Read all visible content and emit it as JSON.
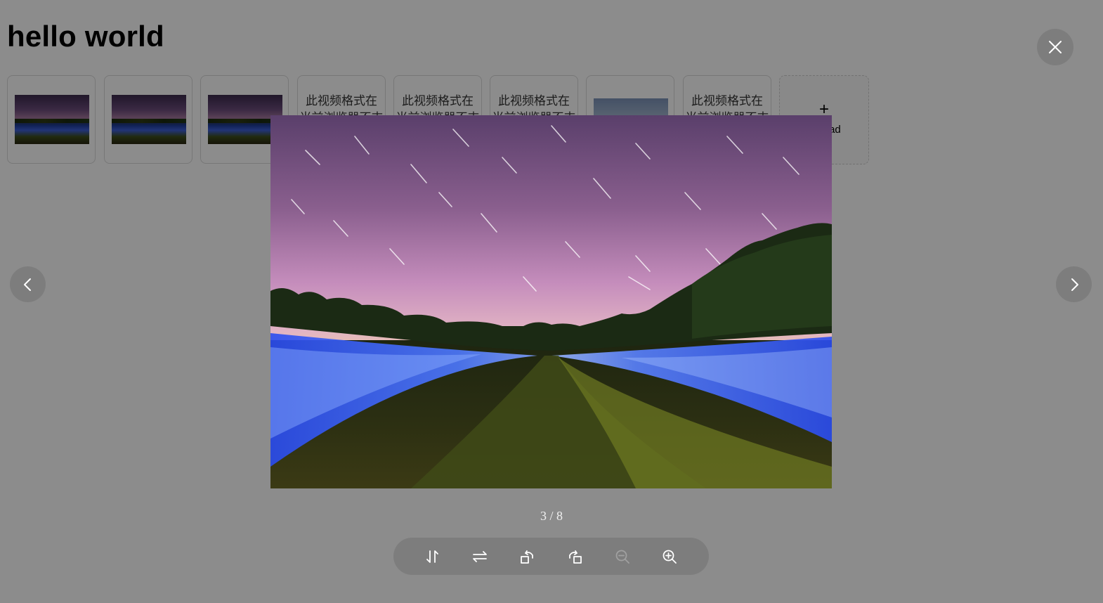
{
  "page": {
    "title": "hello world"
  },
  "upload_list": {
    "items": [
      {
        "type": "image"
      },
      {
        "type": "image"
      },
      {
        "type": "image"
      },
      {
        "type": "video",
        "text_line1": "此视频格式在",
        "text_line2": "当前浏览器不支"
      },
      {
        "type": "video",
        "text_line1": "此视频格式在",
        "text_line2": "当前浏览器不支"
      },
      {
        "type": "video",
        "text_line1": "此视频格式在",
        "text_line2": "当前浏览器不支"
      },
      {
        "type": "image-sky"
      },
      {
        "type": "video",
        "text_line1": "此视频格式在",
        "text_line2": "当前浏览器不支"
      }
    ],
    "upload_button": {
      "icon": "+",
      "label": "Upload"
    }
  },
  "preview": {
    "counter": "3 / 8",
    "current_index": 3,
    "total": 8,
    "close_icon": "close-icon",
    "prev_icon": "chevron-left-icon",
    "next_icon": "chevron-right-icon",
    "toolbar": [
      {
        "name": "flip-vertical",
        "icon": "flip-vertical-icon",
        "disabled": false
      },
      {
        "name": "flip-horizontal",
        "icon": "flip-horizontal-icon",
        "disabled": false
      },
      {
        "name": "rotate-left",
        "icon": "rotate-left-icon",
        "disabled": false
      },
      {
        "name": "rotate-right",
        "icon": "rotate-right-icon",
        "disabled": false
      },
      {
        "name": "zoom-out",
        "icon": "zoom-out-icon",
        "disabled": true
      },
      {
        "name": "zoom-in",
        "icon": "zoom-in-icon",
        "disabled": false
      }
    ]
  },
  "colors": {
    "mask": "rgba(0,0,0,0.45)",
    "icon": "#ffffff",
    "icon_disabled": "#a0a0a0"
  }
}
